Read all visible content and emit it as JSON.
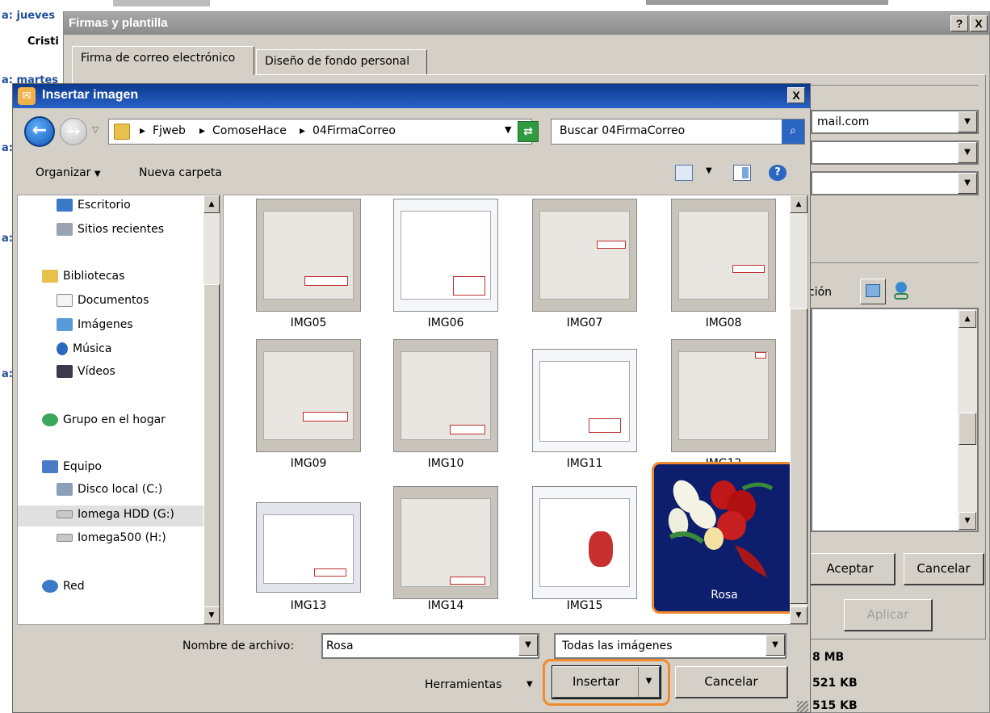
{
  "background": {
    "date_label": "a: jueves",
    "name_label": "Cristi",
    "partial_labels": [
      "a: martes",
      "a:",
      "a:",
      "a:"
    ],
    "sizes": [
      "8 MB",
      "521 KB",
      "515 KB"
    ]
  },
  "firmas_dialog": {
    "title": "Firmas y plantilla",
    "help_button": "?",
    "close_button": "X",
    "tabs": [
      "Firma de correo electrónico",
      "Diseño de fondo personal"
    ],
    "account_value": "mail.com",
    "partial_label_cion": "ción",
    "accept_label": "Aceptar",
    "cancel_label": "Cancelar",
    "apply_label": "Aplicar"
  },
  "insert_dialog": {
    "title": "Insertar imagen",
    "close_button": "X",
    "address": {
      "crumbs": [
        "Fjweb",
        "ComoseHace",
        "04FirmaCorreo"
      ]
    },
    "search_placeholder": "Buscar 04FirmaCorreo",
    "toolbar": {
      "organize": "Organizar",
      "new_folder": "Nueva carpeta"
    },
    "nav": [
      {
        "label": "Escritorio",
        "icon": "desktop-icon"
      },
      {
        "label": "Sitios recientes",
        "icon": "recent-places-icon"
      },
      {
        "label": "Bibliotecas",
        "icon": "libraries-icon"
      },
      {
        "label": "Documentos",
        "icon": "documents-icon"
      },
      {
        "label": "Imágenes",
        "icon": "pictures-icon"
      },
      {
        "label": "Música",
        "icon": "music-icon"
      },
      {
        "label": "Vídeos",
        "icon": "videos-icon"
      },
      {
        "label": "Grupo en el hogar",
        "icon": "homegroup-icon"
      },
      {
        "label": "Equipo",
        "icon": "computer-icon"
      },
      {
        "label": "Disco local (C:)",
        "icon": "local-disk-icon"
      },
      {
        "label": "Iomega HDD (G:)",
        "icon": "drive-icon"
      },
      {
        "label": "Iomega500 (H:)",
        "icon": "drive-icon"
      },
      {
        "label": "Red",
        "icon": "network-icon"
      }
    ],
    "files": [
      "IMG05",
      "IMG06",
      "IMG07",
      "IMG08",
      "IMG09",
      "IMG10",
      "IMG11",
      "IMG12",
      "IMG13",
      "IMG14",
      "IMG15",
      "Rosa"
    ],
    "selected_file": "Rosa",
    "file_name_label": "Nombre de archivo:",
    "file_name_value": "Rosa",
    "file_type_value": "Todas las imágenes",
    "tools_label": "Herramientas",
    "insert_label": "Insertar",
    "cancel_label": "Cancelar"
  },
  "colors": {
    "highlight": "#f08a2c",
    "title_bar": "#1a4fa8",
    "dialog_bg": "#d4d0c8"
  }
}
